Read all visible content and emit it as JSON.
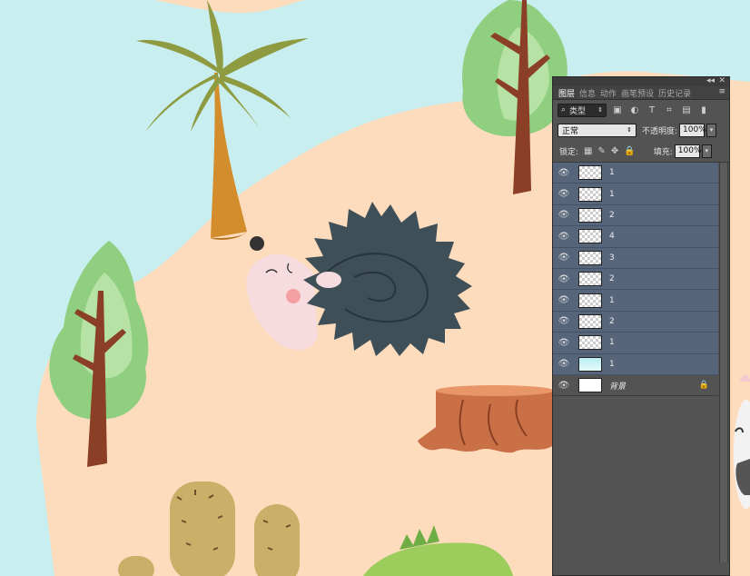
{
  "canvas": {
    "colors": {
      "sky": "#c9eef0",
      "ground": "#fddcbd",
      "palm_trunk": "#d48d2c",
      "palm_leaves": "#8f9b40",
      "tree_foliage": "#8fcf7f",
      "tree_trunk": "#8b3f26",
      "hedgehog_spines": "#3f4f58",
      "hedgehog_face": "#f6dcdf",
      "stump": "#c97047",
      "cactus": "#c9b068",
      "lizard": "#9ccc5c"
    }
  },
  "panel": {
    "window_controls": {
      "collapse": "◂◂",
      "close": "✕"
    },
    "tabs": [
      {
        "label": "图层",
        "active": true
      },
      {
        "label": "信息",
        "active": false
      },
      {
        "label": "动作",
        "active": false
      },
      {
        "label": "画笔预设",
        "active": false
      },
      {
        "label": "历史记录",
        "active": false
      }
    ],
    "panel_menu_icon": "≡",
    "filter": {
      "label": "类型",
      "icons": [
        "image-filter-icon",
        "adjustment-filter-icon",
        "type-filter-icon",
        "shape-filter-icon",
        "smart-object-filter-icon",
        "filter-toggle-icon"
      ],
      "glyphs": [
        "▣",
        "◐",
        "T",
        "⌗",
        "▤",
        "▮"
      ]
    },
    "blend_mode": "正常",
    "opacity_label": "不透明度:",
    "opacity_value": "100%",
    "lock_label": "锁定:",
    "lock_glyphs": [
      "▦",
      "✎",
      "✥",
      "🔒"
    ],
    "fill_label": "填充:",
    "fill_value": "100%",
    "eye_glyph": "👁",
    "layers": [
      {
        "name": "1",
        "thumb": "transparent",
        "selected": true
      },
      {
        "name": "1",
        "thumb": "transparent",
        "selected": true
      },
      {
        "name": "2",
        "thumb": "transparent",
        "selected": true
      },
      {
        "name": "4",
        "thumb": "transparent",
        "selected": true
      },
      {
        "name": "3",
        "thumb": "transparent",
        "selected": true
      },
      {
        "name": "2",
        "thumb": "transparent",
        "selected": true
      },
      {
        "name": "1",
        "thumb": "transparent",
        "selected": true
      },
      {
        "name": "2",
        "thumb": "transparent",
        "selected": true
      },
      {
        "name": "1",
        "thumb": "transparent",
        "selected": true
      },
      {
        "name": "1",
        "thumb": "cyan",
        "selected": true
      },
      {
        "name": "背景",
        "thumb": "white",
        "selected": false,
        "locked": true,
        "lock_glyph": "🔒"
      }
    ]
  }
}
